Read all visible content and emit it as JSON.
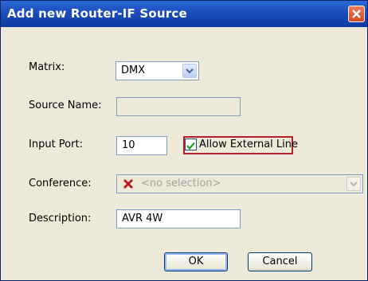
{
  "window": {
    "title": "Add new Router-IF Source"
  },
  "form": {
    "matrix_label": "Matrix:",
    "matrix_value": "DMX",
    "source_name_label": "Source Name:",
    "source_name_value": "",
    "input_port_label": "Input Port:",
    "input_port_value": "10",
    "allow_external_label": "Allow External Line",
    "allow_external_checked": true,
    "conference_label": "Conference:",
    "conference_placeholder": "<no selection>",
    "description_label": "Description:",
    "description_value": "AVR 4W"
  },
  "buttons": {
    "ok": "OK",
    "cancel": "Cancel"
  },
  "colors": {
    "title_bar": "#1d4fbd",
    "highlight_border": "#b3202a",
    "field_border": "#7f9db9"
  },
  "icons": {
    "close": "close-icon",
    "conference_clear": "red-x-icon",
    "dropdown": "chevron-down-icon"
  }
}
